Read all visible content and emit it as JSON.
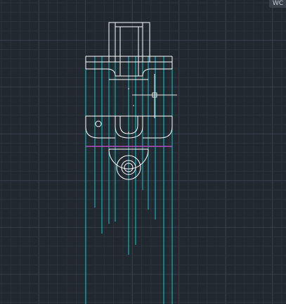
{
  "app": {
    "viewcube_label": "WC",
    "colors": {
      "background": "#212830",
      "grid_minor": "#2b333d",
      "grid_major": "#38414c",
      "geometry_white": "#ffffff",
      "construction_cyan": "#19c9cc",
      "section_magenta": "#b34db8",
      "crosshair": "#e6e6e6"
    },
    "icons": {
      "crosshair": "crosshair-cursor-icon",
      "pickbox": "pickbox-icon"
    }
  }
}
